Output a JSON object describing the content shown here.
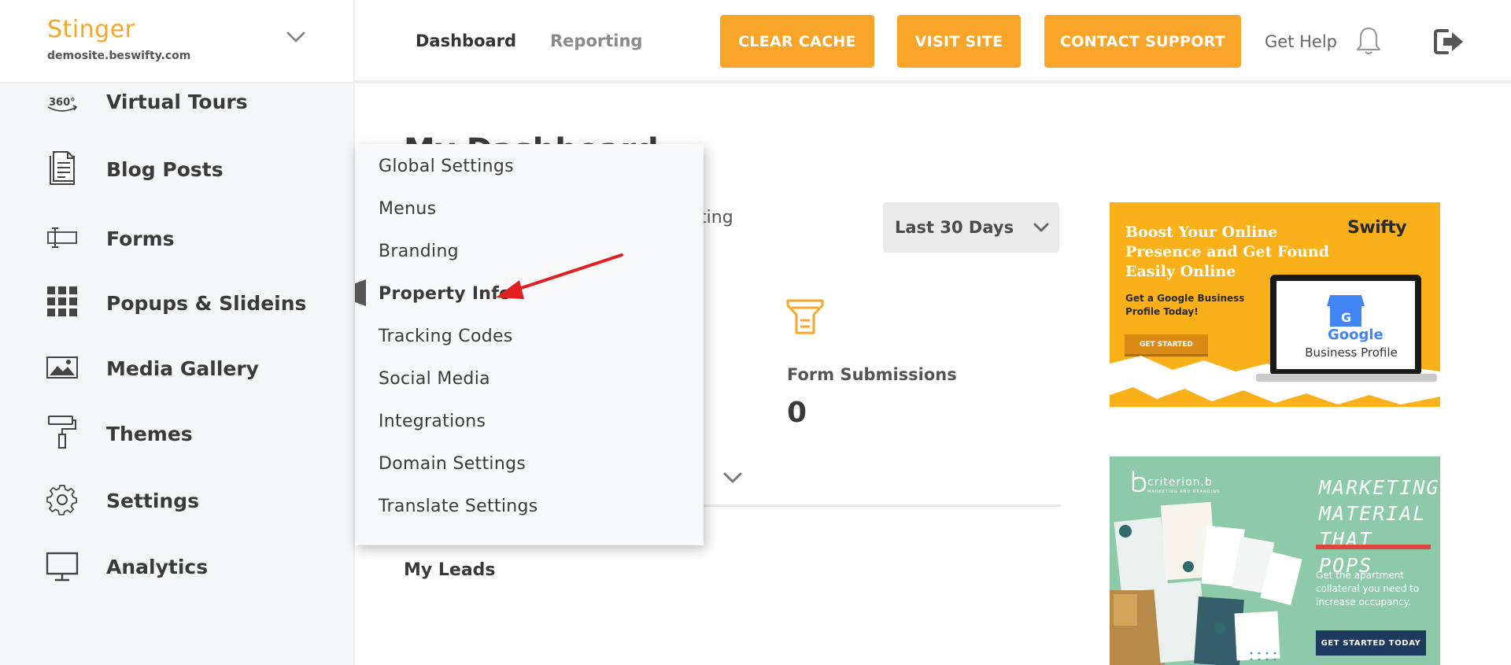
{
  "brand": {
    "name": "Stinger",
    "domain": "demosite.beswifty.com"
  },
  "topnav": {
    "tabs": [
      {
        "label": "Dashboard",
        "active": true
      },
      {
        "label": "Reporting",
        "active": false
      }
    ],
    "buttons": {
      "clear_cache": "CLEAR CACHE",
      "visit_site": "VISIT SITE",
      "contact_support": "CONTACT SUPPORT"
    },
    "get_help": "Get Help"
  },
  "sidebar": {
    "items": [
      {
        "label": "Virtual Tours",
        "icon": "360-icon"
      },
      {
        "label": "Blog Posts",
        "icon": "document-icon"
      },
      {
        "label": "Forms",
        "icon": "form-field-icon"
      },
      {
        "label": "Popups & Slideins",
        "icon": "grid-icon"
      },
      {
        "label": "Media Gallery",
        "icon": "image-icon"
      },
      {
        "label": "Themes",
        "icon": "paint-roller-icon"
      },
      {
        "label": "Settings",
        "icon": "gear-icon"
      },
      {
        "label": "Analytics",
        "icon": "monitor-icon"
      }
    ]
  },
  "settings_menu": {
    "items": [
      {
        "label": "Global Settings"
      },
      {
        "label": "Menus"
      },
      {
        "label": "Branding"
      },
      {
        "label": "Property Info",
        "active": true
      },
      {
        "label": "Tracking Codes"
      },
      {
        "label": "Social Media"
      },
      {
        "label": "Integrations"
      },
      {
        "label": "Domain Settings"
      },
      {
        "label": "Translate Settings"
      }
    ]
  },
  "main": {
    "title": "My Dashboard",
    "reporting_fragment": "rting",
    "date_range": "Last 30 Days",
    "stats": {
      "form_submissions_label": "Form Submissions",
      "form_submissions_value": "0"
    },
    "my_leads": "My Leads"
  },
  "ads": {
    "google": {
      "headline": "Boost Your Online Presence and Get Found Easily Online",
      "sub": "Get a Google Business Profile Today!",
      "button": "GET STARTED",
      "logo": "Swifty",
      "google_word": "Google",
      "business_profile": "Business Profile"
    },
    "criterion": {
      "brand": "criterion.b",
      "brand_sub": "MARKETING AND BRANDING",
      "headline": "MARKETING MATERIAL THAT POPS",
      "sub": "Get the apartment collateral you need to increase occupancy.",
      "button": "GET STARTED TODAY"
    }
  },
  "colors": {
    "accent": "#f8a52a",
    "sidebar_bg": "#f5f6f7",
    "ad_yellow": "#f9b019",
    "ad_green": "#8ccaa9",
    "arrow_red": "#e02020"
  }
}
